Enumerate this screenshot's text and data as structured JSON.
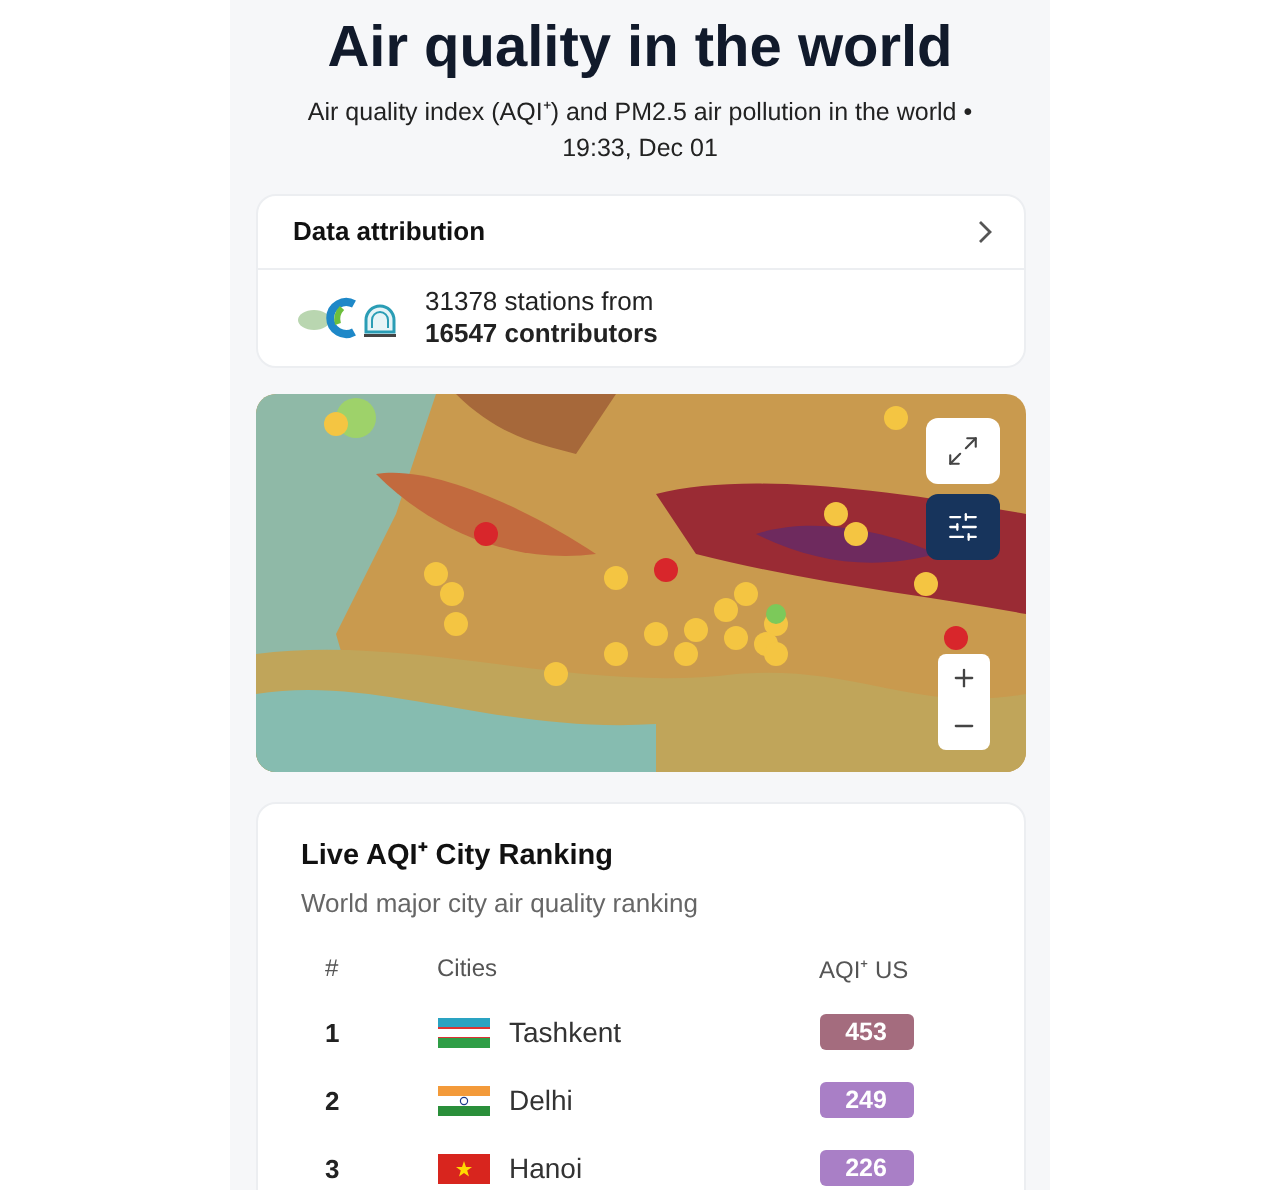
{
  "header": {
    "title": "Air quality in the world",
    "subtitle": "Air quality index (AQI⁺) and PM2.5 air pollution in the world •",
    "timestamp": "19:33, Dec 01"
  },
  "attribution": {
    "title": "Data attribution",
    "stations": "31378 stations from",
    "contributors": "16547 contributors"
  },
  "ranking": {
    "title": "Live AQI⁺ City Ranking",
    "subtitle": "World major city air quality ranking",
    "columns": [
      "#",
      "Cities",
      "AQI⁺ US"
    ],
    "rows": [
      {
        "rank": "1",
        "city": "Tashkent",
        "aqi": "453",
        "color": "#a46c7e"
      },
      {
        "rank": "2",
        "city": "Delhi",
        "aqi": "249",
        "color": "#a97fc6"
      },
      {
        "rank": "3",
        "city": "Hanoi",
        "aqi": "226",
        "color": "#a97fc6"
      }
    ]
  }
}
